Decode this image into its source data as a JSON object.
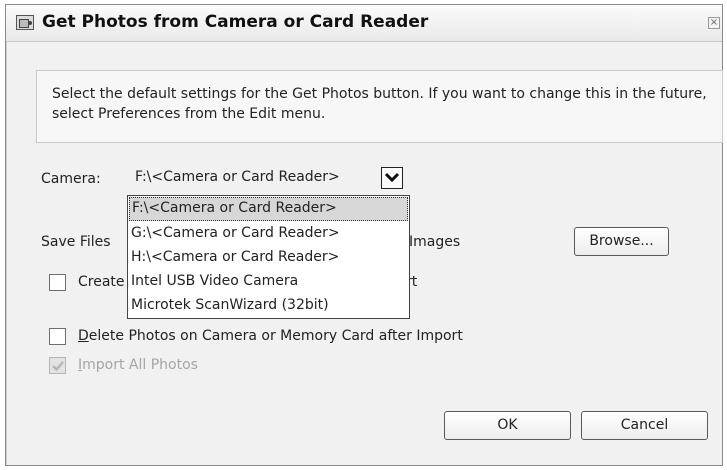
{
  "window": {
    "title": "Get Photos from Camera or Card Reader",
    "close_label": "×"
  },
  "info": {
    "text": "Select the default settings for the Get Photos button. If you want to change this in the future, select Preferences from the Edit menu."
  },
  "camera": {
    "label": "Camera:",
    "selected_value": "F:\\<Camera or Card Reader>",
    "options": [
      "F:\\<Camera or Card Reader>",
      "G:\\<Camera or Card Reader>",
      "H:\\<Camera or Card Reader>",
      "Intel USB Video Camera",
      "Microtek ScanWizard (32bit)"
    ]
  },
  "save_files": {
    "label_visible": "Save Files",
    "label_tail": "Images",
    "browse_label": "Browse..."
  },
  "create_option": {
    "label_visible": "Create",
    "label_tail": "rt",
    "checked": false
  },
  "delete_option": {
    "label": "Delete Photos on Camera or Memory Card after Import",
    "checked": false
  },
  "import_all": {
    "label": "Import All Photos",
    "checked": true,
    "disabled": true
  },
  "buttons": {
    "ok_label": "OK",
    "cancel_label": "Cancel"
  }
}
